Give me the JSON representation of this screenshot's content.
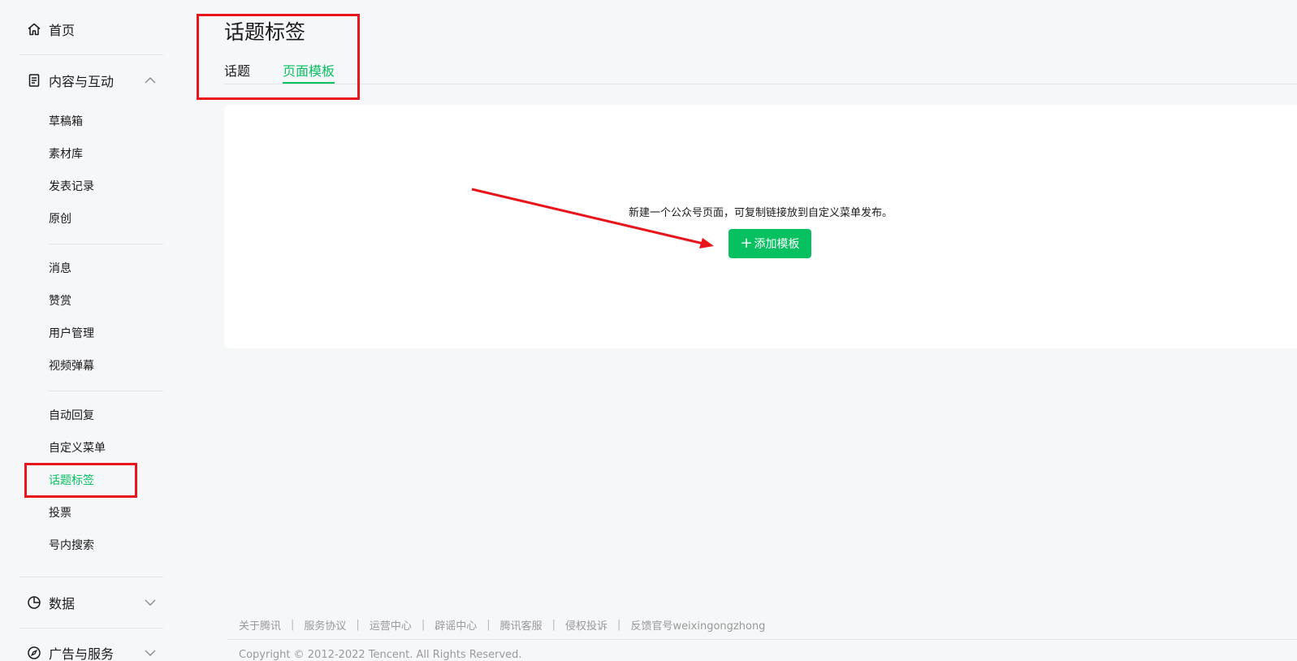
{
  "sidebar": {
    "home_label": "首页",
    "content_group": {
      "label": "内容与互动",
      "items_a": [
        "草稿箱",
        "素材库",
        "发表记录",
        "原创"
      ],
      "items_b": [
        "消息",
        "赞赏",
        "用户管理",
        "视频弹幕"
      ],
      "items_c": [
        "自动回复",
        "自定义菜单",
        "话题标签",
        "投票",
        "号内搜索"
      ],
      "active_item": "话题标签"
    },
    "data_group_label": "数据",
    "ads_group_label": "广告与服务"
  },
  "header": {
    "title": "话题标签",
    "tabs": [
      {
        "label": "话题",
        "active": false
      },
      {
        "label": "页面模板",
        "active": true
      }
    ]
  },
  "main": {
    "empty_hint": "新建一个公众号页面，可复制链接放到自定义菜单发布。",
    "add_button_icon": "+",
    "add_button_label": "添加模板"
  },
  "footer": {
    "links": [
      "关于腾讯",
      "服务协议",
      "运营中心",
      "辟谣中心",
      "腾讯客服",
      "侵权投诉",
      "反馈官号weixingongzhong"
    ],
    "separator": "|",
    "copyright": "Copyright © 2012-2022 Tencent. All Rights Reserved."
  },
  "colors": {
    "accent": "#07c160",
    "annotation": "#e8161c",
    "background": "#f6f7f9"
  },
  "icons": {
    "home": "home-icon",
    "content": "document-icon",
    "data": "pie-chart-icon",
    "ads": "compass-icon",
    "expand": "chevron-up-icon",
    "collapse": "chevron-down-icon"
  }
}
